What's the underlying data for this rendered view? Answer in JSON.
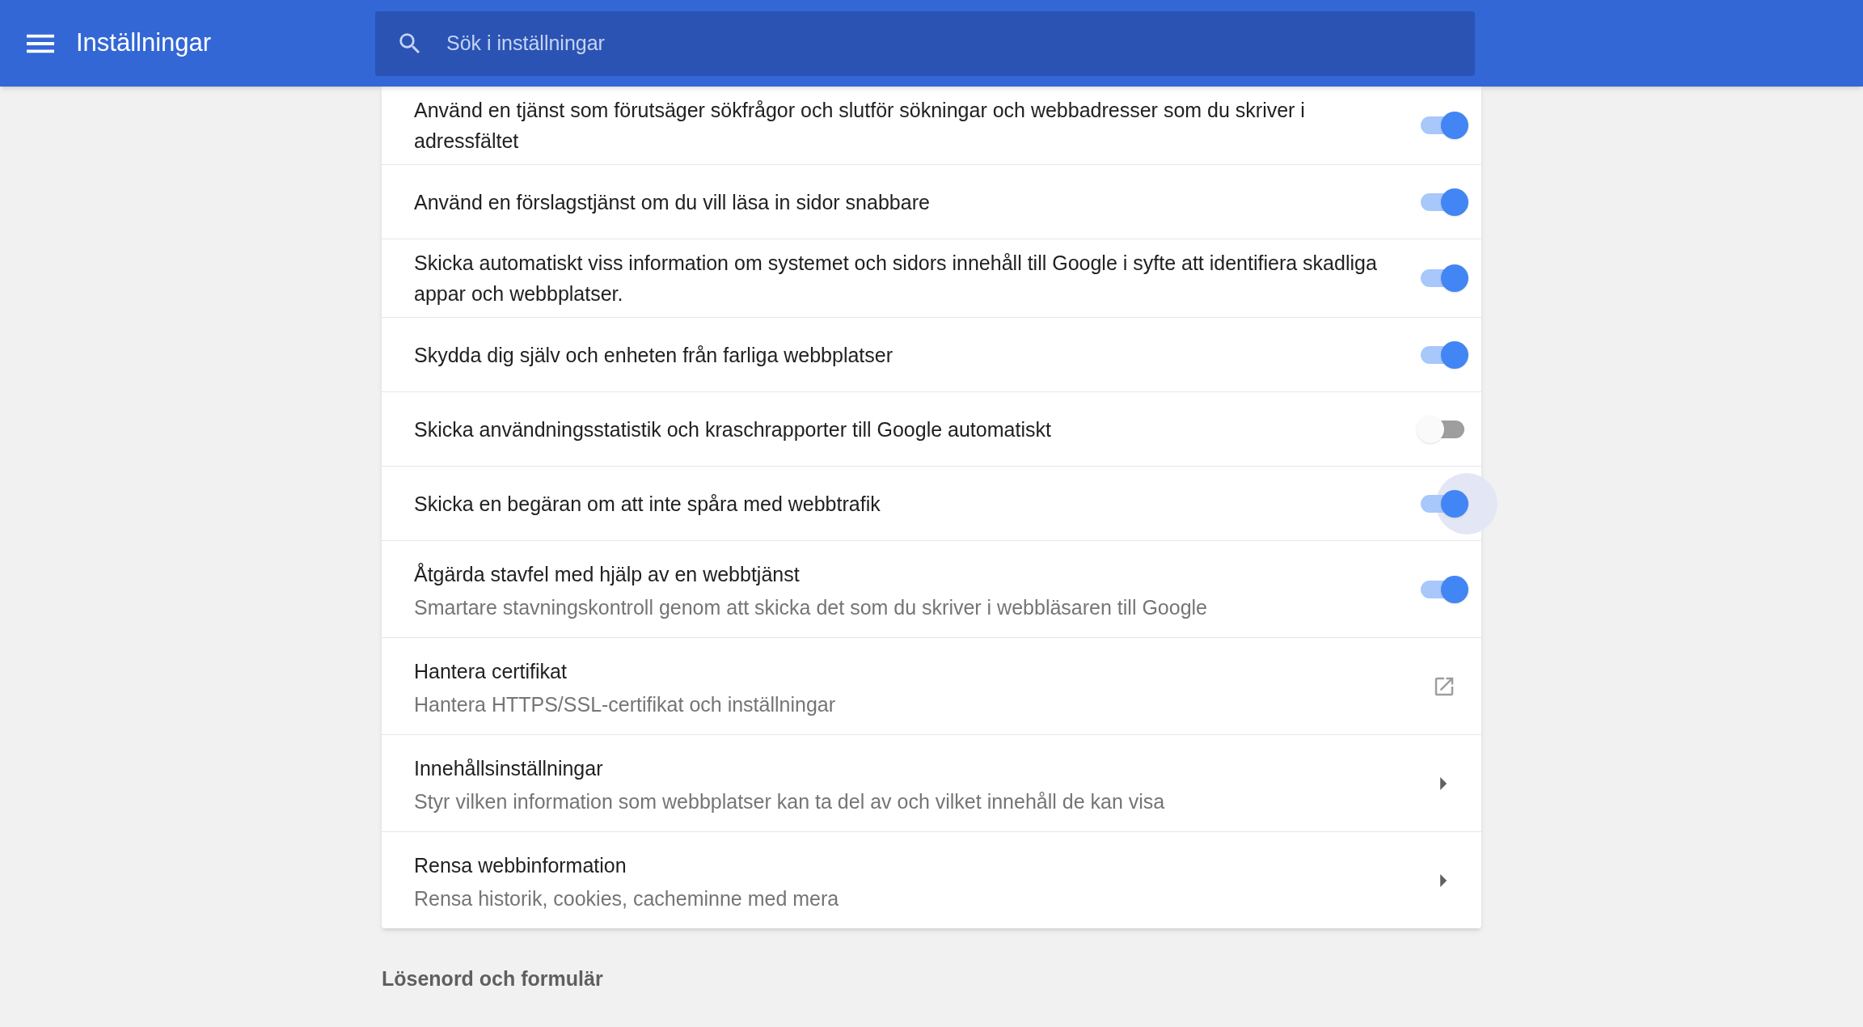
{
  "header": {
    "title": "Inställningar",
    "search": {
      "placeholder": "Sök i inställningar"
    }
  },
  "rows": [
    {
      "kind": "toggle",
      "title": "Använd en tjänst som förutsäger sökfrågor och slutför sökningar och webbadresser som du skriver i adressfältet",
      "on": true
    },
    {
      "kind": "toggle",
      "title": "Använd en förslagstjänst om du vill läsa in sidor snabbare",
      "on": true
    },
    {
      "kind": "toggle",
      "title": "Skicka automatiskt viss information om systemet och sidors innehåll till Google i syfte att identifiera skadliga appar och webbplatser.",
      "on": true
    },
    {
      "kind": "toggle",
      "title": "Skydda dig själv och enheten från farliga webbplatser",
      "on": true
    },
    {
      "kind": "toggle",
      "title": "Skicka användningsstatistik och kraschrapporter till Google automatiskt",
      "on": false
    },
    {
      "kind": "toggle",
      "title": "Skicka en begäran om att inte spåra med webbtrafik",
      "on": true,
      "focused": true
    },
    {
      "kind": "toggle",
      "title": "Åtgärda stavfel med hjälp av en webbtjänst",
      "subtitle": "Smartare stavningskontroll genom att skicka det som du skriver i webbläsaren till Google",
      "on": true
    },
    {
      "kind": "external",
      "title": "Hantera certifikat",
      "subtitle": "Hantera HTTPS/SSL-certifikat och inställningar"
    },
    {
      "kind": "submenu",
      "title": "Innehållsinställningar",
      "subtitle": "Styr vilken information som webbplatser kan ta del av och vilket innehåll de kan visa"
    },
    {
      "kind": "submenu",
      "title": "Rensa webbinformation",
      "subtitle": "Rensa historik, cookies, cacheminne med mera"
    }
  ],
  "next_section": {
    "title": "Lösenord och formulär"
  }
}
